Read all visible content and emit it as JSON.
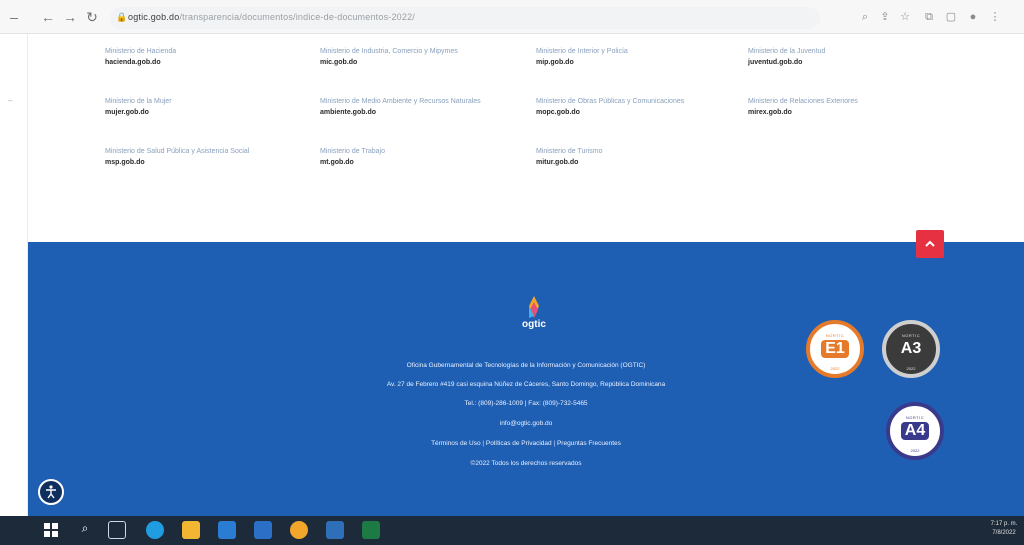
{
  "browser": {
    "back_icon": "arrow-left-icon",
    "forward_icon": "arrow-right-icon",
    "reload_icon": "reload-icon",
    "url_domain": "ogtic.gob.do",
    "url_path": "/transparencia/documentos/indice-de-documentos-2022/"
  },
  "ministries": [
    {
      "name": "Ministerio de Hacienda",
      "domain": "hacienda.gob.do"
    },
    {
      "name": "Ministerio de Industria, Comercio y Mipymes",
      "domain": "mic.gob.do"
    },
    {
      "name": "Ministerio de Interior y Policía",
      "domain": "mip.gob.do"
    },
    {
      "name": "Ministerio de la Juventud",
      "domain": "juventud.gob.do"
    },
    {
      "name": "Ministerio de la Mujer",
      "domain": "mujer.gob.do"
    },
    {
      "name": "Ministerio de Medio Ambiente y Recursos Naturales",
      "domain": "ambiente.gob.do"
    },
    {
      "name": "Ministerio de Obras Públicas y Comunicaciones",
      "domain": "mopc.gob.do"
    },
    {
      "name": "Ministerio de Relaciones Exteriores",
      "domain": "mirex.gob.do"
    },
    {
      "name": "Ministerio de Salud Pública y Asistencia Social",
      "domain": "msp.gob.do"
    },
    {
      "name": "Ministerio de Trabajo",
      "domain": "mt.gob.do"
    },
    {
      "name": "Ministerio de Turismo",
      "domain": "mitur.gob.do"
    }
  ],
  "footer": {
    "logo_text": "ogtic",
    "org_name": "Oficina Gubernamental de Tecnologías de la Información y Comunicación (OGTIC)",
    "address": "Av. 27 de Febrero #419 casi esquina Núñez de Cáceres, Santo Domingo, República Dominicana",
    "phone": "Tel.: (809)-286-1009 | Fax: (809)-732-5465",
    "email": "info@ogtic.gob.do",
    "links": [
      "Términos de Uso",
      "Políticas de Privacidad",
      "Preguntas Frecuentes"
    ],
    "copyright": "©2022 Todos los derechos reservados"
  },
  "badges": [
    {
      "code": "E1",
      "top": "NORTIC",
      "year": "2022",
      "color": "#e57b2a"
    },
    {
      "code": "A3",
      "top": "NORTIC",
      "year": "2022",
      "color": "#3b3b3b"
    },
    {
      "code": "A4",
      "top": "NORTIC",
      "year": "2022",
      "color": "#3a3a8c"
    }
  ],
  "taskbar": {
    "time": "7:17 p. m.",
    "date": "7/8/2022"
  },
  "colors": {
    "footer_bg": "#1e5fb3",
    "scroll_top_bg": "#e53141",
    "ministry_name": "#8aa0bd"
  }
}
